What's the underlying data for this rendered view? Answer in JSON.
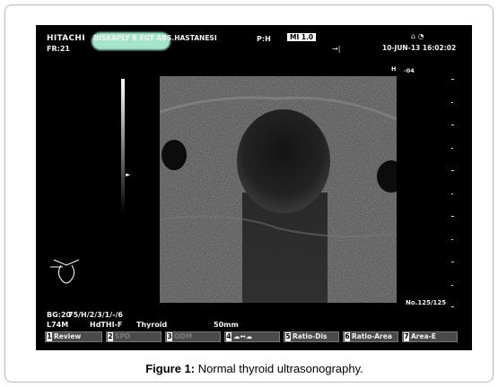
{
  "screen": {
    "logo": "HITACHI",
    "institution": "DISKAPLY B EGT ARS.HASTANESI",
    "frame_rate": "FR:21",
    "probe": "P:H",
    "mi_badge": "MI 1.0",
    "datetime": "10-JUN-13 16:02:02",
    "direction_mark": "H",
    "angle": "-04",
    "frame_counter": "No.125/125",
    "gain": "BG:20",
    "params": "75/H/2/3/1/-/6",
    "mode_left": "L74M",
    "mode_mid": "HdTHI-F",
    "organ": "Thyroid",
    "depth": "50mm",
    "icons": [
      "speaker-icon",
      "cursor-icon",
      "body-mark-icon"
    ]
  },
  "menu": [
    {
      "num": "1",
      "label": "Review",
      "active": true
    },
    {
      "num": "2",
      "label": "SPD",
      "active": false
    },
    {
      "num": "3",
      "label": "ODM",
      "active": false
    },
    {
      "num": "4",
      "label": "",
      "active": true
    },
    {
      "num": "5",
      "label": "Ratio-Dis",
      "active": true
    },
    {
      "num": "6",
      "label": "Ratio-Area",
      "active": true
    },
    {
      "num": "7",
      "label": "Area-E",
      "active": true
    }
  ],
  "caption": {
    "label": "Figure 1:",
    "text": "Normal thyroid ultrasonography."
  }
}
